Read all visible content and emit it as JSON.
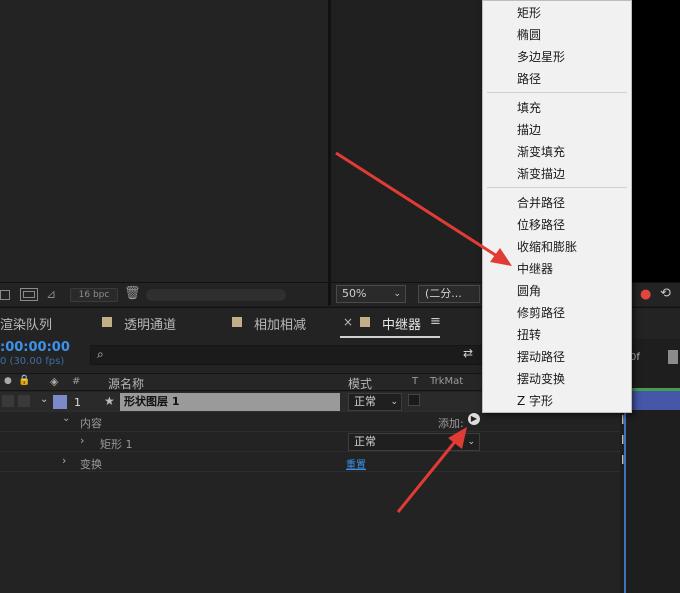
{
  "viewer": {
    "bpc": "16 bpc",
    "zoom": "50%",
    "resolution": "(二分..."
  },
  "tabs": {
    "render_queue": "渲染队列",
    "transparent": "透明通道",
    "multiply": "相加相减",
    "active": "中继器",
    "close": "×",
    "menu": "≡"
  },
  "timeline": {
    "timecode": ":00:00:00",
    "fps": "0 (30.00 fps)",
    "ruler_label": "0f",
    "columns": {
      "num": "#",
      "source_name": "源名称",
      "mode": "模式",
      "t": "T",
      "trkmat": "TrkMat"
    },
    "layer": {
      "index": "1",
      "name": "形状图层 1",
      "mode": "正常"
    },
    "contents": {
      "label": "内容",
      "add_label": "添加:",
      "shape": "矩形 1",
      "shape_mode": "正常"
    },
    "transform": {
      "label": "变换",
      "reset": "重置"
    }
  },
  "menu": {
    "items": [
      "矩形",
      "椭圆",
      "多边星形",
      "路径",
      "填充",
      "描边",
      "渐变填充",
      "渐变描边",
      "合并路径",
      "位移路径",
      "收缩和膨胀",
      "中继器",
      "圆角",
      "修剪路径",
      "扭转",
      "摆动路径",
      "摆动变换",
      "Z 字形"
    ]
  },
  "colors": {
    "timecode": "#3c93e9",
    "label_tan": "#c2ae87",
    "layer_color": "#7b8ac8",
    "arrow": "#e13b35"
  }
}
